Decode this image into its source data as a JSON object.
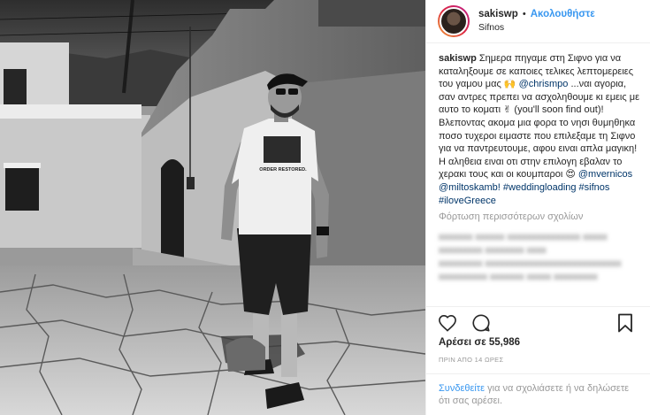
{
  "header": {
    "username": "sakiswp",
    "separator": "•",
    "follow_label": "Ακολουθήστε",
    "location": "Sifnos"
  },
  "caption": {
    "username": "sakiswp",
    "text_1": "Σημερα πηγαμε στη Σιφνο για να καταληξουμε σε καποιες τελικες λεπτομερειες του γαμου μας 🙌",
    "mention_1": "@chrismpo",
    "text_2": "...ναι αγορια, σαν αντρες πρεπει να ασχοληθουμε κι εμεις με αυτο το κοματι ✌ (you'll soon find out)!",
    "text_3": "Βλεποντας ακομα μια φορα το νησι θυμηθηκα ποσο τυχεροι ειμαστε που επιλεξαμε τη Σιφνο για να παντρευτουμε, αφου ειναι απλα μαγικη! Η αληθεια ειναι οτι στην επιλογη εβαλαν το χερακι τους και οι κουμπαροι 😍",
    "mention_2": "@mvernicos",
    "mention_3": "@miltoskamb!",
    "hashtags": "#weddingloading #sifnos #iloveGreece"
  },
  "load_more_label": "Φόρτωση περισσότερων σχολίων",
  "blurred_comments": [
    "xxxxxxx  xxxxxx xxxxxxxxxxxxxxx xxxxx",
    "xxxxxxxxx  xxxxxxxx xxxx",
    "xxxxxxxxx  xxxxxxxxxxxxxxxxxxxxxxxxxxxx",
    "xxxxxxxxxx  xxxxxxx xxxxx xxxxxxxxx"
  ],
  "likes": "Αρέσει σε 55,986",
  "timestamp": "ΠΡΙΝ ΑΠΟ 14 ΩΡΕΣ",
  "login": {
    "link_label": "Συνδεθείτε",
    "rest_text": "για να σχολιάσετε ή να δηλώσετε ότι σας αρέσει."
  },
  "photo": {
    "shirt_text": "ORDER RESTORED."
  },
  "icons": {
    "like": "heart-icon",
    "comment": "comment-icon",
    "save": "bookmark-icon"
  },
  "colors": {
    "link_blue": "#3897f0",
    "mention_dark": "#003569",
    "muted": "#999999"
  }
}
